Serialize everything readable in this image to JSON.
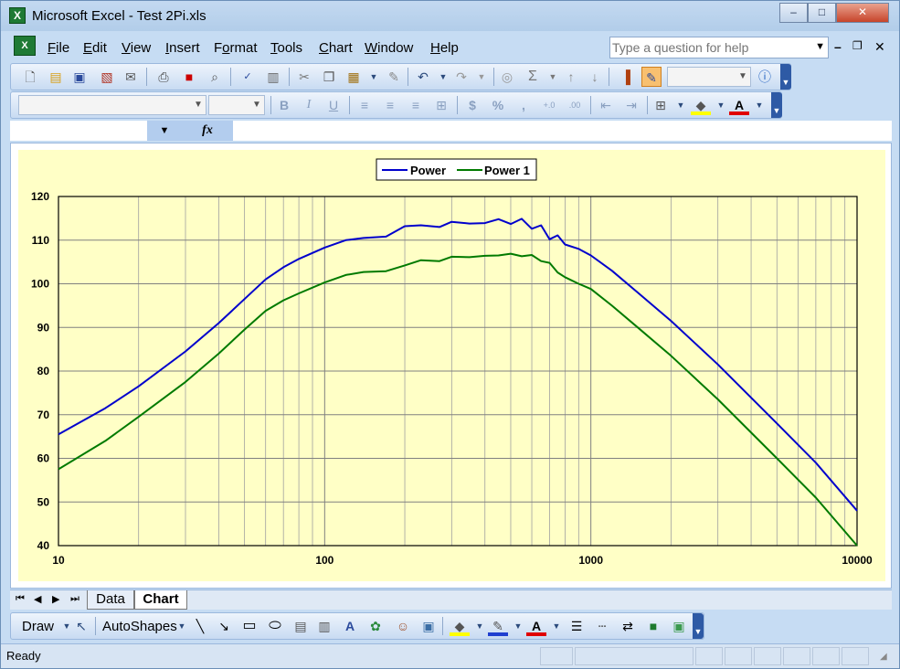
{
  "window": {
    "title": "Microsoft Excel - Test 2Pi.xls",
    "app_icon": "X"
  },
  "menu": {
    "items": [
      {
        "label": "File",
        "accel": "F"
      },
      {
        "label": "Edit",
        "accel": "E"
      },
      {
        "label": "View",
        "accel": "V"
      },
      {
        "label": "Insert",
        "accel": "I"
      },
      {
        "label": "Format",
        "accel": "o"
      },
      {
        "label": "Tools",
        "accel": "T"
      },
      {
        "label": "Chart",
        "accel": "C"
      },
      {
        "label": "Window",
        "accel": "W"
      },
      {
        "label": "Help",
        "accel": "H"
      }
    ],
    "help_placeholder": "Type a question for help"
  },
  "formatting": {
    "font_name": "",
    "font_size": "",
    "bold": "B",
    "italic": "I",
    "underline": "U",
    "currency": "$",
    "percent": "%",
    "comma": ",",
    "inc_decimal": "+.0",
    "dec_decimal": ".00",
    "font_color_letter": "A"
  },
  "formula_bar": {
    "fx": "fx",
    "name_box": "",
    "content": ""
  },
  "sheet_tabs": {
    "tabs": [
      "Data",
      "Chart"
    ],
    "active": "Chart"
  },
  "draw_toolbar": {
    "draw_label": "Draw",
    "autoshapes_label": "AutoShapes",
    "font_color_letter": "A"
  },
  "status": {
    "text": "Ready"
  },
  "colors": {
    "power": "#0000cc",
    "power1": "#007a00",
    "chart_bg": "#ffffc6"
  },
  "chart_data": {
    "type": "line",
    "x_scale": "log",
    "xlim": [
      10,
      10000
    ],
    "ylim": [
      40,
      120
    ],
    "x_ticks": [
      "10",
      "100",
      "1000",
      "10000"
    ],
    "y_ticks": [
      "120",
      "110",
      "100",
      "90",
      "80",
      "70",
      "60",
      "50",
      "40"
    ],
    "grid": true,
    "legend": "top-center",
    "series": [
      {
        "name": "Power",
        "x": [
          10,
          15,
          20,
          30,
          40,
          50,
          60,
          70,
          80,
          100,
          120,
          140,
          170,
          200,
          230,
          270,
          300,
          350,
          400,
          450,
          500,
          550,
          600,
          650,
          700,
          750,
          800,
          900,
          1000,
          1200,
          1500,
          2000,
          3000,
          5000,
          7000,
          10000
        ],
        "y": [
          65.5,
          71.5,
          76.5,
          84.5,
          91,
          96.5,
          101,
          103.8,
          105.7,
          108.3,
          110,
          110.5,
          110.8,
          113.2,
          113.4,
          113,
          114.2,
          113.8,
          113.9,
          114.8,
          113.7,
          114.9,
          112.6,
          113.4,
          110.2,
          111.1,
          109,
          108,
          106.5,
          103,
          98,
          91.5,
          81.5,
          68,
          59,
          48
        ]
      },
      {
        "name": "Power 1",
        "x": [
          10,
          15,
          20,
          30,
          40,
          50,
          60,
          70,
          80,
          100,
          120,
          140,
          170,
          200,
          230,
          270,
          300,
          350,
          400,
          450,
          500,
          550,
          600,
          650,
          700,
          750,
          800,
          900,
          1000,
          1200,
          1500,
          2000,
          3000,
          5000,
          7000,
          10000
        ],
        "y": [
          57.5,
          64,
          69.5,
          77.5,
          84,
          89.5,
          93.8,
          96.2,
          97.8,
          100.3,
          102,
          102.7,
          102.9,
          104.2,
          105.4,
          105.2,
          106.2,
          106.1,
          106.4,
          106.5,
          106.9,
          106.3,
          106.6,
          105.2,
          104.8,
          102.6,
          101.5,
          100,
          98.8,
          95,
          90,
          83.5,
          73.5,
          60,
          51,
          40
        ]
      }
    ]
  }
}
